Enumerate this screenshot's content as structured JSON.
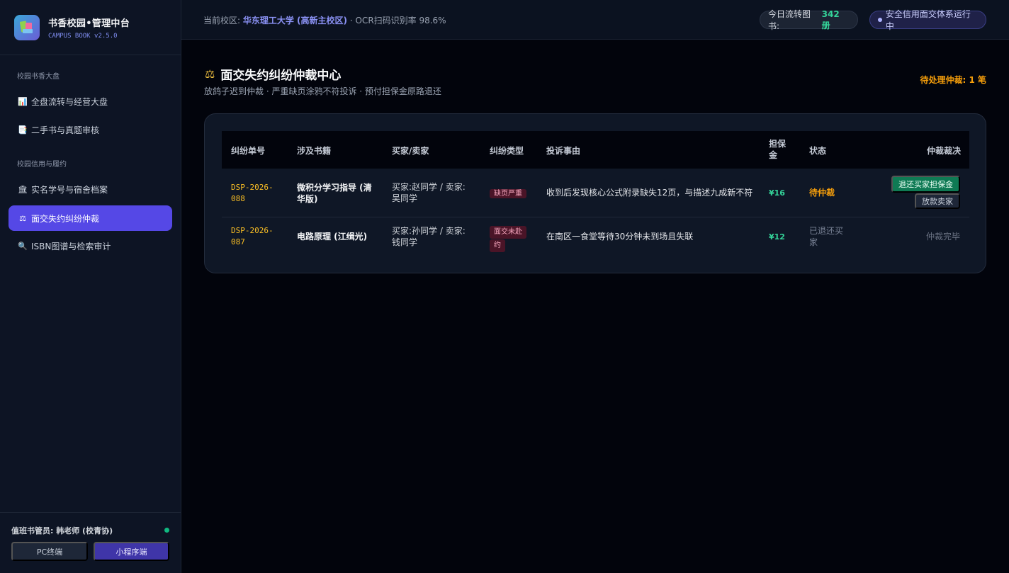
{
  "brand": {
    "title": "书香校园•管理中台",
    "subtitle": "CAMPUS BOOK v2.5.0"
  },
  "sidebar": {
    "sections": [
      {
        "label": "校园书香大盘"
      },
      {
        "label": "校园信用与履约"
      }
    ],
    "items": [
      {
        "icon": "chart-icon",
        "glyph": "📊",
        "label": "全盘流转与经营大盘"
      },
      {
        "icon": "book-icon",
        "glyph": "📑",
        "label": "二手书与真题审核"
      },
      {
        "icon": "bank-icon",
        "glyph": "🏛",
        "label": "实名学号与宿舍档案"
      },
      {
        "icon": "scales-icon",
        "glyph": "⚖",
        "label": "面交失约纠纷仲裁",
        "active": true
      },
      {
        "icon": "magnifier-icon",
        "glyph": "🔍",
        "label": "ISBN图谱与检索审计"
      }
    ],
    "footer": {
      "operator": "值班书管员: 韩老师 (校青协)",
      "pc_label": "PC终端",
      "mini_label": "小程序端"
    }
  },
  "topbar": {
    "campus_prefix": "当前校区:",
    "campus_name": "华东理工大学 (高新主校区)",
    "ocr_text": "· OCR扫码识别率 98.6%",
    "books_label": "今日流转图书:",
    "books_value": "342 册",
    "status_text": "安全信用面交体系运行中"
  },
  "page": {
    "title_icon": "⚖",
    "title": "面交失约纠纷仲裁中心",
    "subtitle": "放鸽子迟到仲裁 · 严重缺页涂鸦不符投诉 · 预付担保金原路退还",
    "pending": "待处理仲裁: 1 笔"
  },
  "table": {
    "headers": [
      "纠纷单号",
      "涉及书籍",
      "买家/卖家",
      "纠纷类型",
      "投诉事由",
      "担保金",
      "状态",
      "仲裁裁决"
    ],
    "rows": [
      {
        "id_line1": "DSP-2026-",
        "id_line2": "088",
        "book_line1": "微积分学习指导 (清",
        "book_line2": "华版)",
        "party_line1": "买家:赵同学 / 卖家:",
        "party_line2": "吴同学",
        "type": "缺页严重",
        "reason": "收到后发现核心公式附录缺失12页，与描述九成新不符",
        "deposit": "¥16",
        "status": "待仲裁",
        "action_refund": "退还买家担保金",
        "action_release": "放款卖家"
      },
      {
        "id_line1": "DSP-2026-",
        "id_line2": "087",
        "book_line1": "电路原理 (江缉光)",
        "party_line1": "买家:孙同学 / 卖家:",
        "party_line2": "钱同学",
        "type_line1": "面交未赴",
        "type_line2": "约",
        "reason": "在南区一食堂等待30分钟未到场且失联",
        "deposit": "¥12",
        "status_line1": "已退还买",
        "status_line2": "家",
        "action_done": "仲裁完毕"
      }
    ]
  }
}
